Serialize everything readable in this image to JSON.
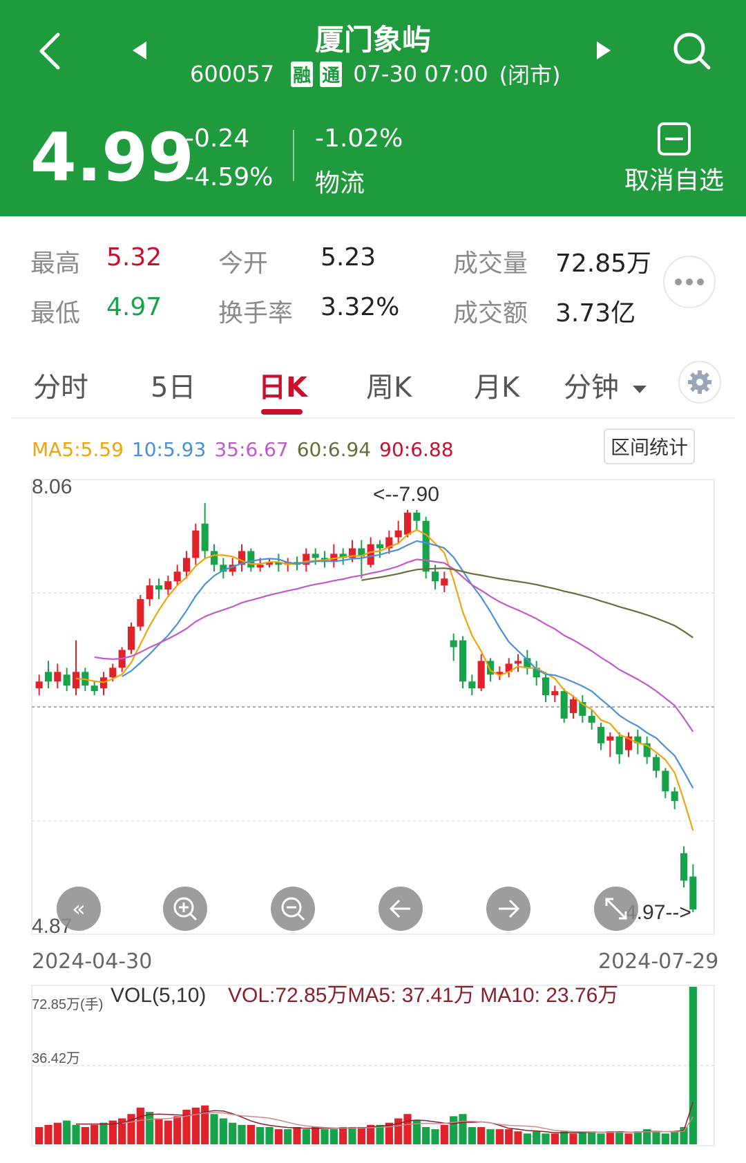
{
  "header": {
    "title": "厦门象屿",
    "code": "600057",
    "badge1": "融",
    "badge2": "通",
    "datetime": "07-30 07:00",
    "status": "(闭市)",
    "price": "4.99",
    "change": "-0.24",
    "change_pct": "-4.59%",
    "sector_change": "-1.02%",
    "sector_name": "物流",
    "watch_label": "取消自选"
  },
  "stats": {
    "high_label": "最高",
    "high": "5.32",
    "low_label": "最低",
    "low": "4.97",
    "open_label": "今开",
    "open": "5.23",
    "turnover_label": "换手率",
    "turnover": "3.32%",
    "volume_label": "成交量",
    "volume": "72.85万",
    "amount_label": "成交额",
    "amount": "3.73亿"
  },
  "tabs": [
    {
      "label": "分时"
    },
    {
      "label": "5日"
    },
    {
      "label": "日K"
    },
    {
      "label": "周K"
    },
    {
      "label": "月K"
    },
    {
      "label": "分钟"
    }
  ],
  "ma": {
    "ma5": "MA5:5.59",
    "ma10": "10:5.93",
    "ma35": "35:6.67",
    "ma60": "60:6.94",
    "ma90": "90:6.88"
  },
  "range_stats_label": "区间统计",
  "colors": {
    "up": "#e0222b",
    "down": "#17a34a",
    "header_bg": "#1f9a3d",
    "ma5": "#f0a30a",
    "ma10": "#4a90d9",
    "ma35": "#c05acb",
    "ma60": "#6b6b3a",
    "ma90": "#c8102e"
  },
  "chart_data": [
    {
      "type": "candlestick",
      "y_top_label": "8.06",
      "y_bottom_label": "4.87",
      "ylim": [
        4.87,
        8.06
      ],
      "x_start_label": "2024-04-30",
      "x_end_label": "2024-07-29",
      "max_annotation": "<--7.90",
      "min_annotation": "4.97-->",
      "candles": [
        [
          6.6,
          6.65,
          6.55,
          6.7
        ],
        [
          6.72,
          6.65,
          6.6,
          6.8
        ],
        [
          6.65,
          6.72,
          6.6,
          6.78
        ],
        [
          6.7,
          6.62,
          6.58,
          6.75
        ],
        [
          6.6,
          6.72,
          6.55,
          6.95
        ],
        [
          6.72,
          6.62,
          6.58,
          6.75
        ],
        [
          6.62,
          6.58,
          6.55,
          6.65
        ],
        [
          6.6,
          6.68,
          6.55,
          6.72
        ],
        [
          6.68,
          6.75,
          6.65,
          6.78
        ],
        [
          6.75,
          6.88,
          6.72,
          6.9
        ],
        [
          6.88,
          7.05,
          6.85,
          7.08
        ],
        [
          7.05,
          7.25,
          7.02,
          7.28
        ],
        [
          7.25,
          7.35,
          7.2,
          7.4
        ],
        [
          7.35,
          7.32,
          7.25,
          7.4
        ],
        [
          7.32,
          7.38,
          7.28,
          7.42
        ],
        [
          7.38,
          7.45,
          7.35,
          7.5
        ],
        [
          7.45,
          7.55,
          7.4,
          7.6
        ],
        [
          7.55,
          7.75,
          7.5,
          7.8
        ],
        [
          7.8,
          7.6,
          7.55,
          7.95
        ],
        [
          7.6,
          7.5,
          7.45,
          7.65
        ],
        [
          7.5,
          7.45,
          7.4,
          7.55
        ],
        [
          7.45,
          7.5,
          7.42,
          7.55
        ],
        [
          7.5,
          7.6,
          7.45,
          7.65
        ],
        [
          7.6,
          7.48,
          7.45,
          7.62
        ],
        [
          7.48,
          7.5,
          7.45,
          7.55
        ],
        [
          7.5,
          7.52,
          7.48,
          7.55
        ],
        [
          7.52,
          7.5,
          7.45,
          7.58
        ],
        [
          7.5,
          7.52,
          7.45,
          7.55
        ],
        [
          7.52,
          7.5,
          7.46,
          7.56
        ],
        [
          7.5,
          7.58,
          7.45,
          7.62
        ],
        [
          7.58,
          7.55,
          7.5,
          7.62
        ],
        [
          7.55,
          7.52,
          7.48,
          7.6
        ],
        [
          7.52,
          7.58,
          7.48,
          7.65
        ],
        [
          7.58,
          7.55,
          7.5,
          7.62
        ],
        [
          7.55,
          7.62,
          7.52,
          7.68
        ],
        [
          7.62,
          7.56,
          7.4,
          7.68
        ],
        [
          7.5,
          7.65,
          7.48,
          7.7
        ],
        [
          7.65,
          7.62,
          7.55,
          7.68
        ],
        [
          7.62,
          7.7,
          7.58,
          7.75
        ],
        [
          7.7,
          7.75,
          7.65,
          7.82
        ],
        [
          7.72,
          7.88,
          7.7,
          7.9
        ],
        [
          7.88,
          7.82,
          7.75,
          7.9
        ],
        [
          7.82,
          7.45,
          7.4,
          7.85
        ],
        [
          7.45,
          7.38,
          7.32,
          7.5
        ],
        [
          7.35,
          7.4,
          7.3,
          7.45
        ],
        [
          6.95,
          6.9,
          6.8,
          7.0
        ],
        [
          6.95,
          6.65,
          6.6,
          6.98
        ],
        [
          6.65,
          6.6,
          6.55,
          6.7
        ],
        [
          6.6,
          6.8,
          6.58,
          6.85
        ],
        [
          6.8,
          6.7,
          6.65,
          6.82
        ],
        [
          6.7,
          6.72,
          6.66,
          6.76
        ],
        [
          6.72,
          6.78,
          6.68,
          6.82
        ],
        [
          6.78,
          6.8,
          6.72,
          6.85
        ],
        [
          6.82,
          6.75,
          6.7,
          6.88
        ],
        [
          6.75,
          6.68,
          6.62,
          6.8
        ],
        [
          6.68,
          6.55,
          6.5,
          6.72
        ],
        [
          6.55,
          6.58,
          6.5,
          6.62
        ],
        [
          6.58,
          6.38,
          6.35,
          6.6
        ],
        [
          6.42,
          6.52,
          6.38,
          6.55
        ],
        [
          6.5,
          6.4,
          6.35,
          6.55
        ],
        [
          6.4,
          6.35,
          6.3,
          6.45
        ],
        [
          6.32,
          6.2,
          6.15,
          6.35
        ],
        [
          6.22,
          6.25,
          6.1,
          6.28
        ],
        [
          6.25,
          6.12,
          6.05,
          6.28
        ],
        [
          6.15,
          6.25,
          6.1,
          6.28
        ],
        [
          6.25,
          6.2,
          6.12,
          6.3
        ],
        [
          6.2,
          6.1,
          6.05,
          6.25
        ],
        [
          6.1,
          6.0,
          5.95,
          6.12
        ],
        [
          6.0,
          5.85,
          5.8,
          6.02
        ],
        [
          5.85,
          5.78,
          5.72,
          5.88
        ],
        [
          5.4,
          5.2,
          5.15,
          5.45
        ],
        [
          5.23,
          4.99,
          4.97,
          5.32
        ]
      ]
    },
    {
      "type": "bar",
      "title": "VOL(5,10)",
      "summary": "VOL:72.85万MA5: 37.41万 MA10: 23.76万",
      "y_top_label": "72.85万(手)",
      "y_mid_label": "36.42万",
      "ylim": [
        0,
        72.85
      ],
      "values": [
        8,
        9,
        10,
        11,
        9,
        8,
        9,
        10,
        11,
        12,
        14,
        17,
        15,
        12,
        11,
        13,
        16,
        17,
        18,
        14,
        12,
        10,
        9,
        9,
        8,
        8,
        7,
        7,
        8,
        7,
        8,
        7,
        7,
        8,
        8,
        8,
        9,
        9,
        10,
        12,
        14,
        11,
        8,
        7,
        9,
        13,
        14,
        8,
        8,
        7,
        7,
        7,
        6,
        5,
        6,
        5,
        5,
        6,
        5,
        6,
        6,
        5,
        6,
        6,
        5,
        6,
        7,
        6,
        5,
        6,
        8,
        72.85
      ],
      "colors_up_down": [
        1,
        1,
        1,
        0,
        0,
        1,
        1,
        0,
        1,
        1,
        1,
        1,
        0,
        1,
        1,
        1,
        1,
        1,
        1,
        0,
        0,
        0,
        0,
        1,
        0,
        0,
        1,
        0,
        1,
        0,
        1,
        0,
        0,
        1,
        0,
        1,
        1,
        0,
        1,
        1,
        1,
        0,
        0,
        0,
        1,
        0,
        0,
        0,
        1,
        0,
        1,
        1,
        1,
        0,
        0,
        0,
        1,
        0,
        1,
        0,
        0,
        0,
        1,
        0,
        1,
        0,
        0,
        0,
        0,
        0,
        0,
        0
      ]
    }
  ],
  "bottom_buttons": [
    "double-left-icon",
    "zoom-in-icon",
    "zoom-out-icon",
    "arrow-left-icon",
    "arrow-right-icon",
    "fullscreen-icon"
  ]
}
